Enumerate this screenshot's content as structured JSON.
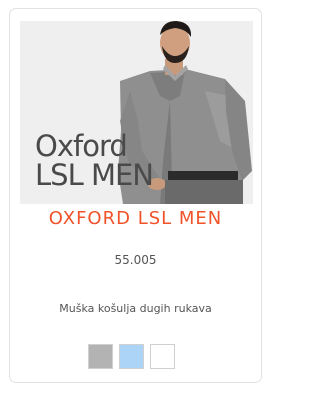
{
  "product": {
    "image_caption_line1": "Oxford",
    "image_caption_line2": "LSL MEN",
    "title": "OXFORD LSL MEN",
    "price": "55.005",
    "description": "Muška košulja dugih rukava",
    "swatches": [
      {
        "name": "gray",
        "color": "#b3b3b3"
      },
      {
        "name": "light-blue",
        "color": "#acd4f7"
      },
      {
        "name": "white",
        "color": "#ffffff"
      }
    ]
  },
  "colors": {
    "accent": "#f0532a",
    "text": "#555555",
    "border": "#e2e2e2"
  }
}
